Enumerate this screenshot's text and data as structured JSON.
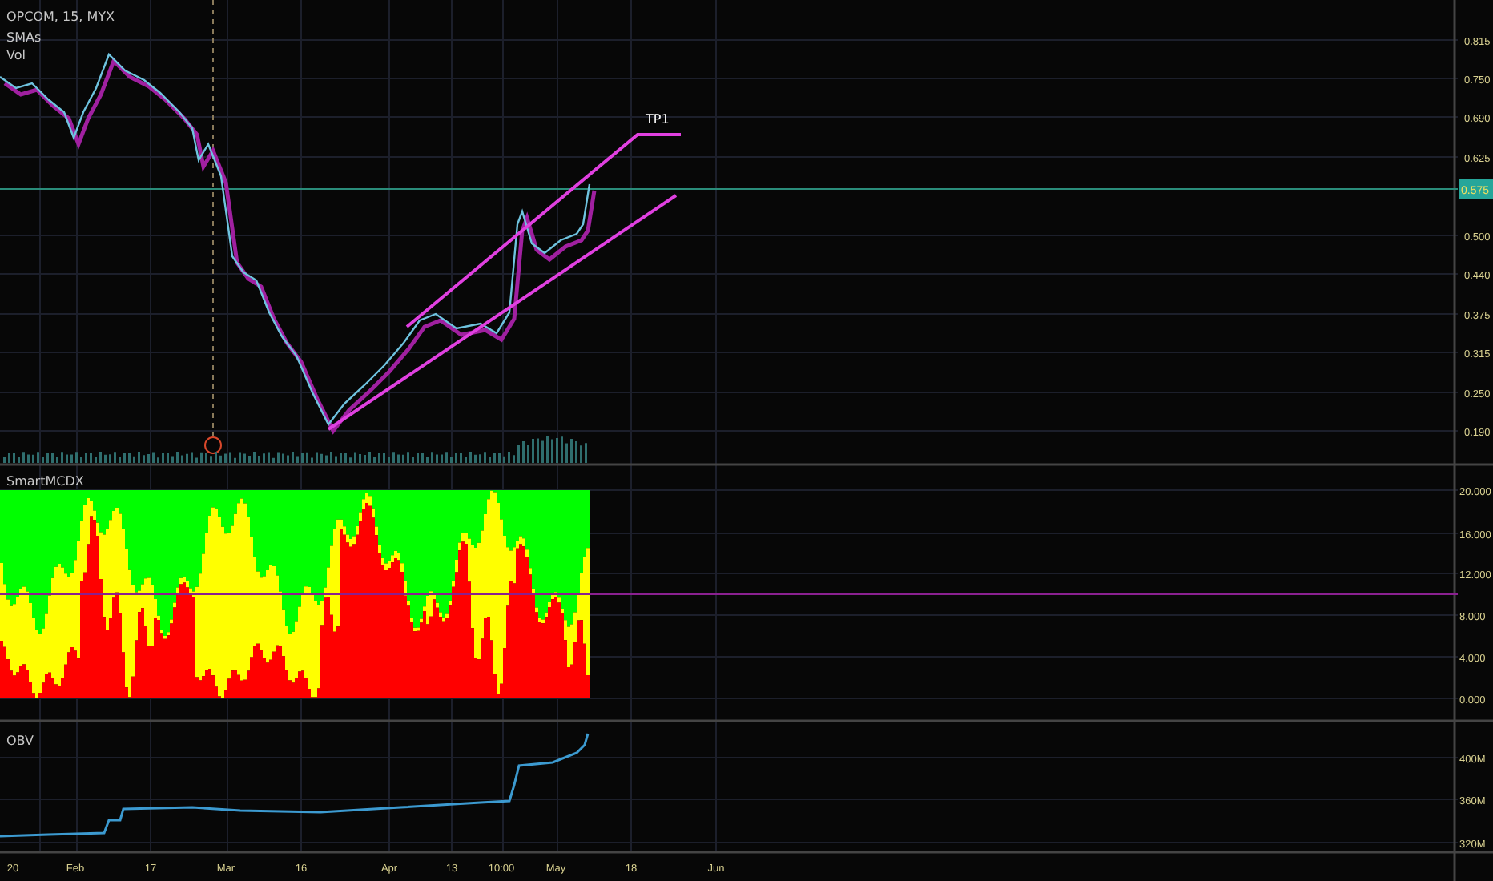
{
  "legend": {
    "symbol": "OPCOM, 15, MYX",
    "indicators": [
      "SMAs",
      "Vol"
    ]
  },
  "price_axis": {
    "labels": [
      "0.815",
      "0.750",
      "0.690",
      "0.625",
      "0.500",
      "0.440",
      "0.375",
      "0.315",
      "0.250",
      "0.190"
    ],
    "last_price": "0.575"
  },
  "annotation": {
    "label": "TP1"
  },
  "panes": [
    {
      "title": "SmartMCDX",
      "axis_labels": [
        "20.000",
        "16.000",
        "12.000",
        "8.000",
        "4.000",
        "0.000"
      ]
    },
    {
      "title": "OBV",
      "axis_labels": [
        "400M",
        "360M",
        "320M"
      ]
    }
  ],
  "time_axis": {
    "labels": [
      "20",
      "Feb",
      "17",
      "Mar",
      "16",
      "Apr",
      "13",
      "10:00",
      "May",
      "18",
      "Jun"
    ]
  }
}
